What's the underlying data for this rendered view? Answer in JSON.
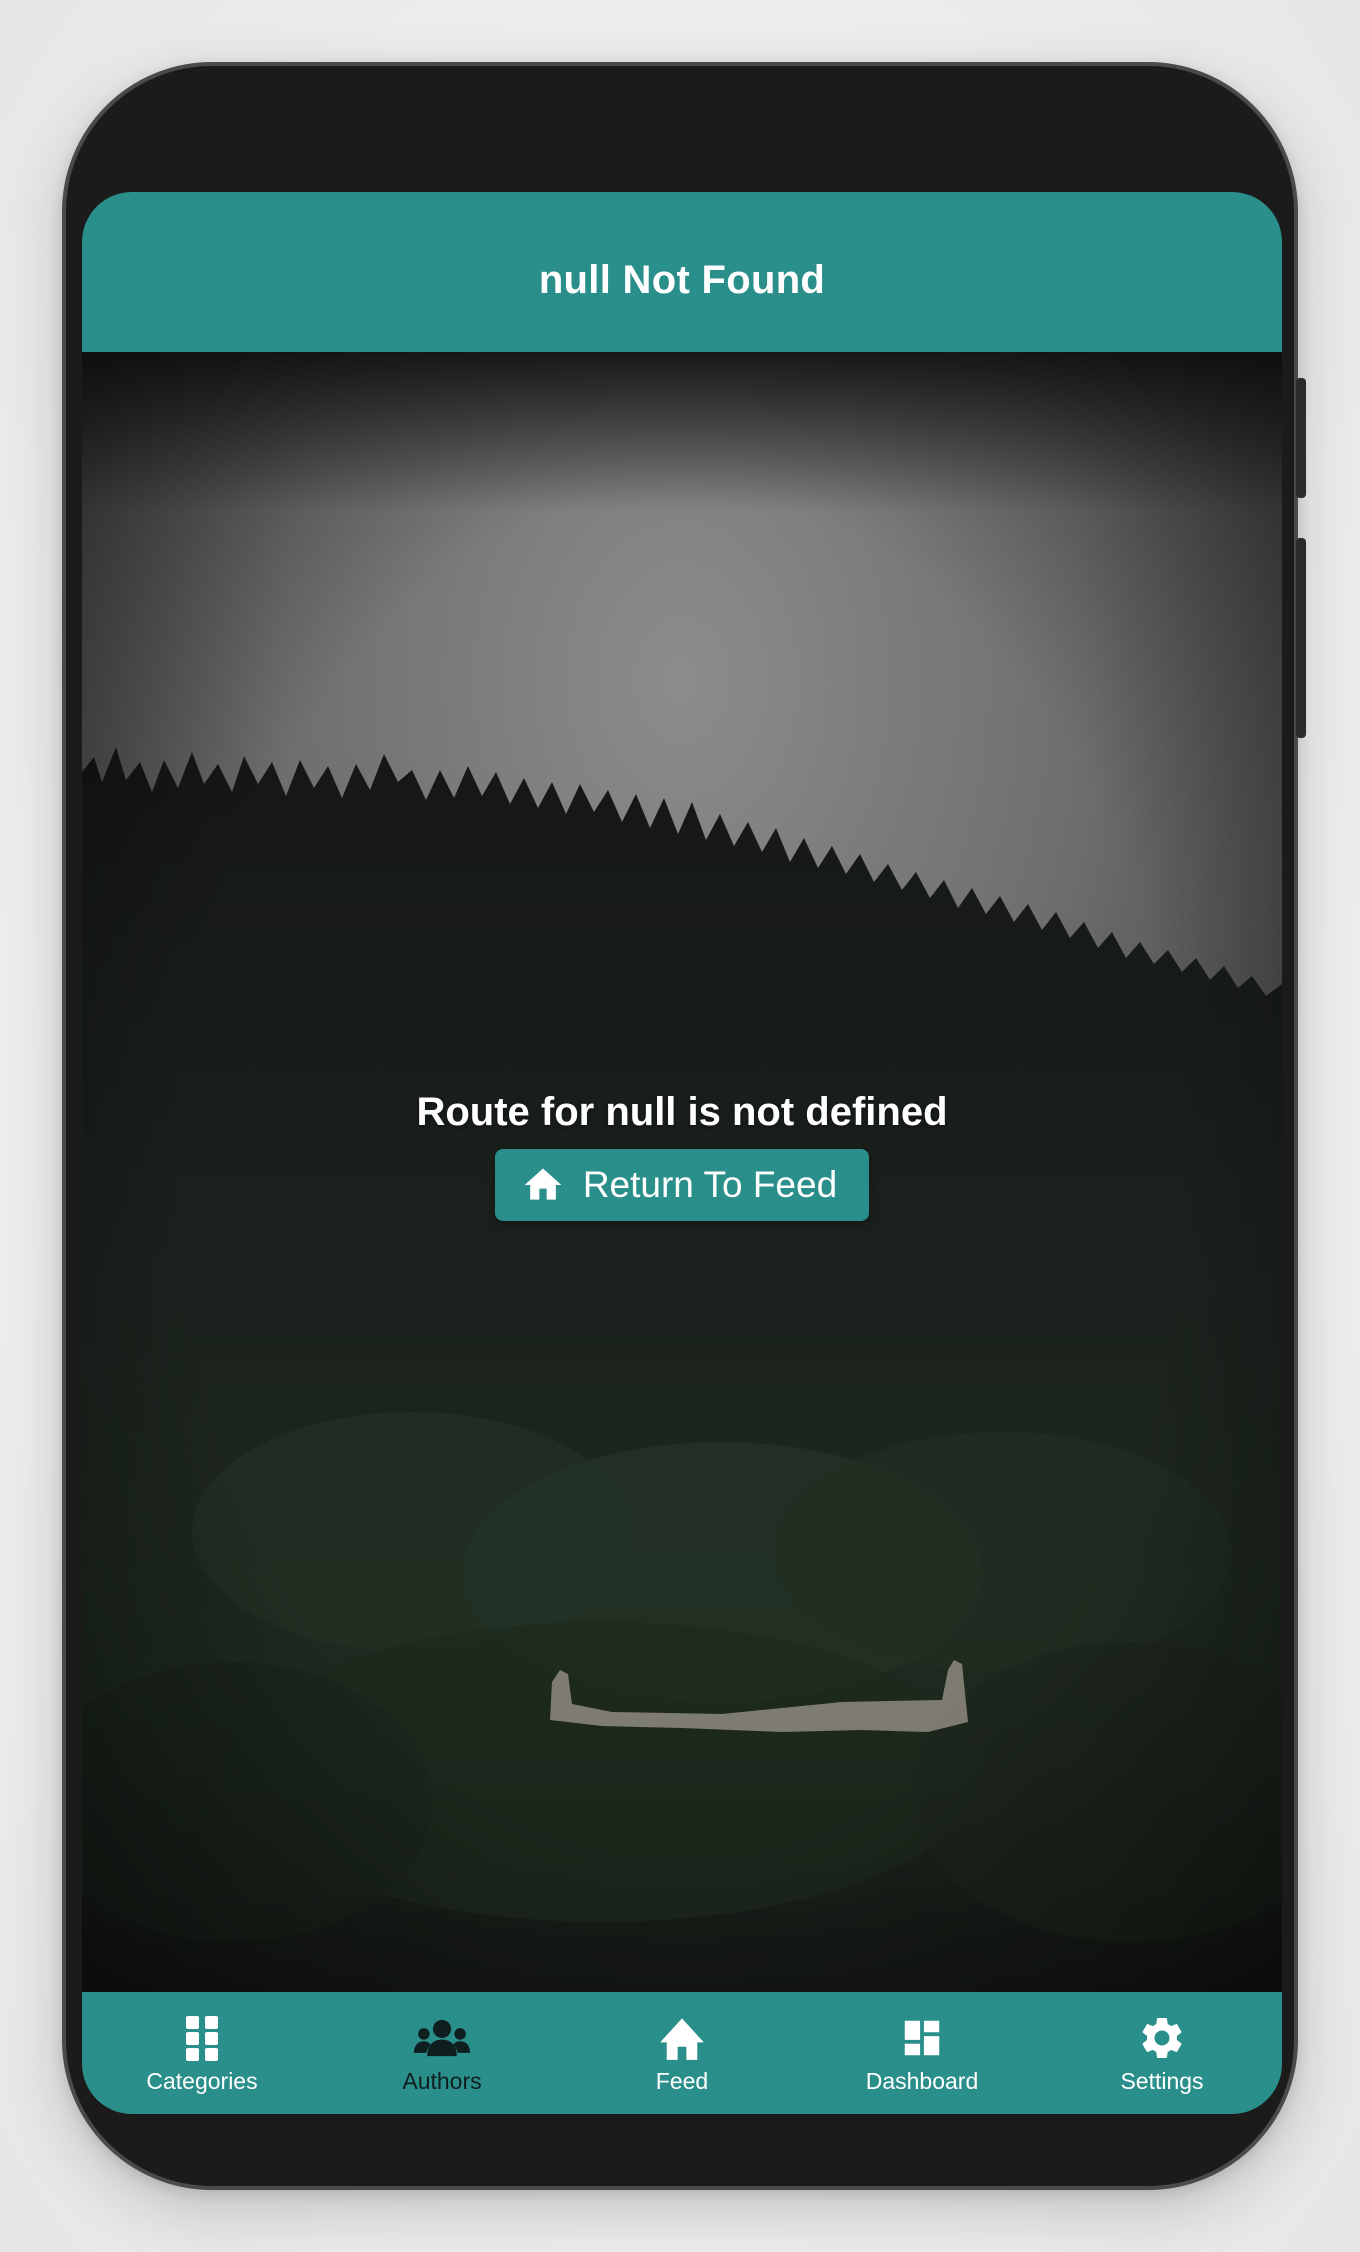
{
  "appbar": {
    "title": "null Not Found"
  },
  "main": {
    "message": "Route for null is not defined",
    "return_button": {
      "label": "Return To Feed",
      "icon": "home-icon"
    }
  },
  "bottom_nav": {
    "active": "Authors",
    "items": [
      {
        "label": "Categories",
        "icon": "apps-grid-icon"
      },
      {
        "label": "Authors",
        "icon": "people-group-icon"
      },
      {
        "label": "Feed",
        "icon": "home-icon"
      },
      {
        "label": "Dashboard",
        "icon": "dashboard-icon"
      },
      {
        "label": "Settings",
        "icon": "gear-icon"
      }
    ]
  },
  "colors": {
    "accent": "#2a8f8a",
    "frame": "#1b1b1b",
    "text_light": "#ffffff",
    "active_nav_icon": "#0f1e1e"
  }
}
